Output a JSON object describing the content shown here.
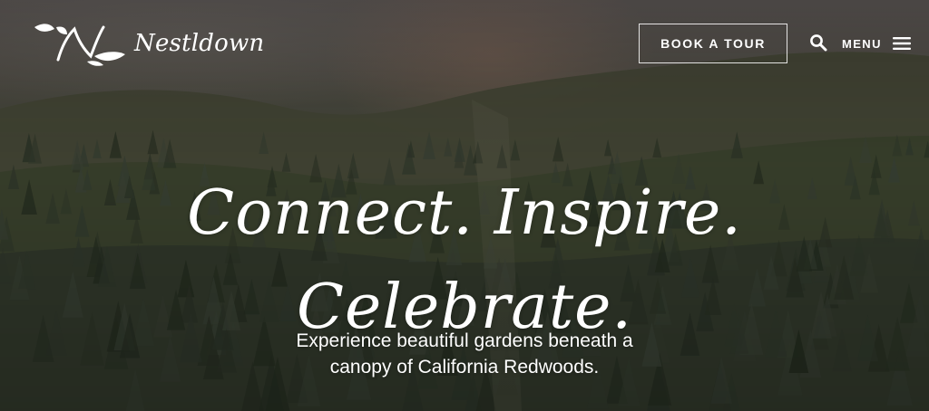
{
  "header": {
    "brand_name": "Nestldown",
    "book_tour_label": "BOOK A TOUR",
    "menu_label": "MENU"
  },
  "hero": {
    "headline_line1": "Connect. Inspire.",
    "headline_line2": "Celebrate.",
    "subtext_line1": "Experience beautiful gardens beneath a",
    "subtext_line2": "canopy of California Redwoods."
  },
  "icons": {
    "logo": "n-monogram-leaf-icon",
    "search": "search-icon",
    "menu": "hamburger-menu-icon"
  },
  "colors": {
    "text": "#ffffff",
    "forest_dark": "#2b2f24",
    "haze": "#5b5654"
  }
}
